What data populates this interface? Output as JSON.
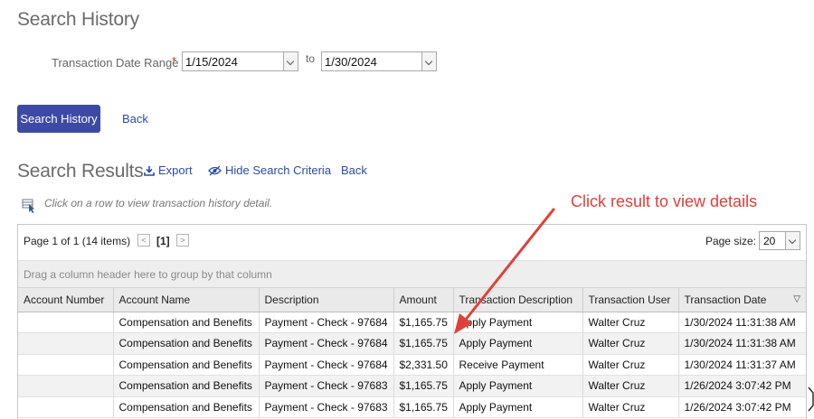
{
  "page": {
    "title": "Search History",
    "date_range_label": "Transaction Date Range",
    "required_marker": "*",
    "date_from": "1/15/2024",
    "to_label": "to",
    "date_to": "1/30/2024",
    "search_button": "Search History",
    "back_link": "Back"
  },
  "results": {
    "title": "Search Results",
    "export_label": "Export",
    "hide_criteria_label": "Hide Search Criteria",
    "back_label": "Back",
    "hint": "Click on a row to view transaction history detail.",
    "callout": "Click result to view details"
  },
  "grid": {
    "pager_info": "Page 1 of 1 (14 items)",
    "prev_symbol": "<",
    "current_page": "[1]",
    "next_symbol": ">",
    "page_size_label": "Page size:",
    "page_size_value": "20",
    "group_panel_text": "Drag a column header here to group by that column",
    "columns": [
      "Account Number",
      "Account Name",
      "Description",
      "Amount",
      "Transaction Description",
      "Transaction User",
      "Transaction Date"
    ],
    "sort_indicator": "▽",
    "rows": [
      [
        "",
        "Compensation and Benefits",
        "Payment - Check - 97684",
        "$1,165.75",
        "Apply Payment",
        "Walter Cruz",
        "1/30/2024 11:31:38 AM"
      ],
      [
        "",
        "Compensation and Benefits",
        "Payment - Check - 97684",
        "$1,165.75",
        "Apply Payment",
        "Walter Cruz",
        "1/30/2024 11:31:38 AM"
      ],
      [
        "",
        "Compensation and Benefits",
        "Payment - Check - 97684",
        "$2,331.50",
        "Receive Payment",
        "Walter Cruz",
        "1/30/2024 11:31:37 AM"
      ],
      [
        "",
        "Compensation and Benefits",
        "Payment - Check - 97683",
        "$1,165.75",
        "Apply Payment",
        "Walter Cruz",
        "1/26/2024 3:07:42 PM"
      ],
      [
        "",
        "Compensation and Benefits",
        "Payment - Check - 97683",
        "$1,165.75",
        "Apply Payment",
        "Walter Cruz",
        "1/26/2024 3:07:42 PM"
      ]
    ]
  },
  "colors": {
    "primary_button": "#3d4aa5",
    "link": "#2e4aa8",
    "callout": "#e0403a"
  }
}
